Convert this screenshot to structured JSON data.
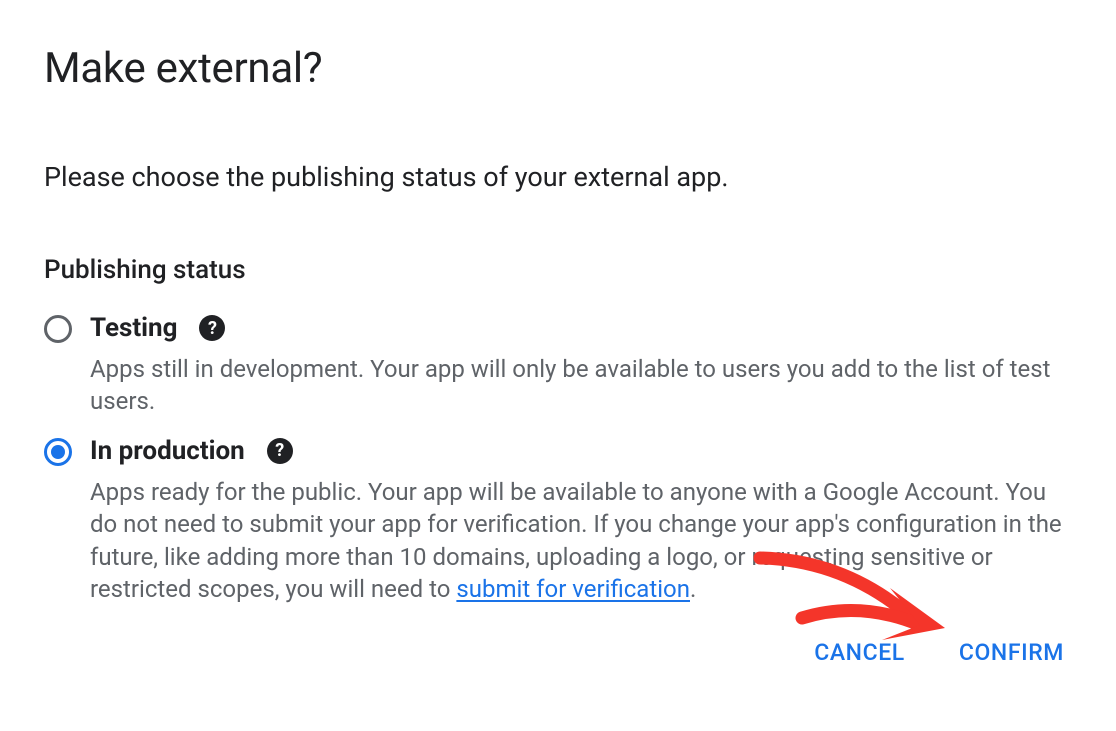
{
  "dialog": {
    "title": "Make external?",
    "prompt": "Please choose the publishing status of your external app.",
    "section_heading": "Publishing status",
    "options": {
      "testing": {
        "label": "Testing",
        "description": "Apps still in development. Your app will only be available to users you add to the list of test users.",
        "selected": false
      },
      "production": {
        "label": "In production",
        "description_pre": "Apps ready for the public. Your app will be available to anyone with a Google Account. You do not need to submit your app for verification. If you change your app's configuration in the future, like adding more than 10 domains, uploading a logo, or requesting sensitive or restricted scopes, you will need to ",
        "link_text": "submit for verification",
        "description_post": ".",
        "selected": true
      }
    },
    "actions": {
      "cancel": "CANCEL",
      "confirm": "CONFIRM"
    }
  }
}
